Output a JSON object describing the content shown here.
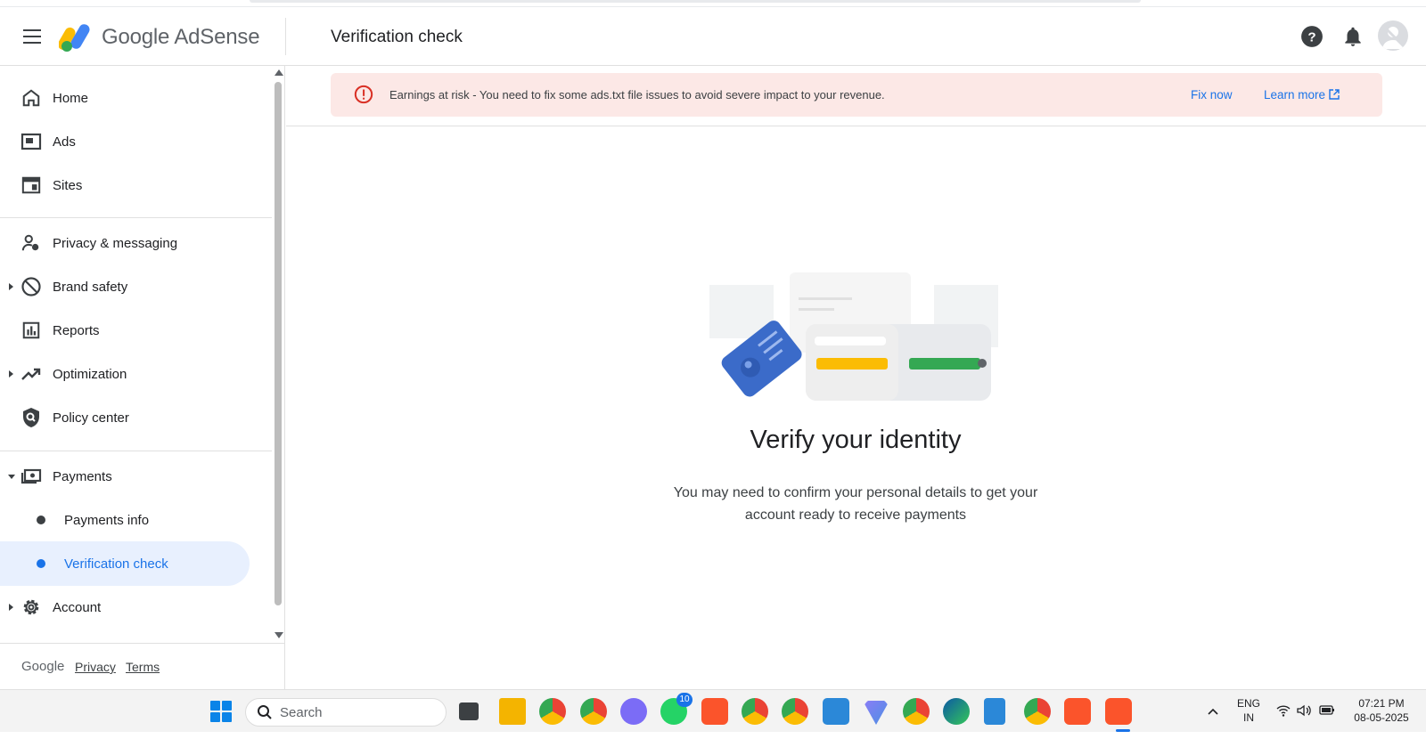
{
  "header": {
    "brand": "Google AdSense",
    "page_title": "Verification check"
  },
  "sidebar": {
    "items": [
      {
        "label": "Home",
        "icon": "home-icon"
      },
      {
        "label": "Ads",
        "icon": "ads-icon"
      },
      {
        "label": "Sites",
        "icon": "sites-icon"
      },
      {
        "label": "Privacy & messaging",
        "icon": "privacy-icon"
      },
      {
        "label": "Brand safety",
        "icon": "block-icon"
      },
      {
        "label": "Reports",
        "icon": "reports-icon"
      },
      {
        "label": "Optimization",
        "icon": "trending-icon"
      },
      {
        "label": "Policy center",
        "icon": "policy-shield-icon"
      },
      {
        "label": "Payments",
        "icon": "payments-icon"
      },
      {
        "label": "Payments info"
      },
      {
        "label": "Verification check"
      },
      {
        "label": "Account",
        "icon": "gear-icon"
      }
    ],
    "footer": {
      "google": "Google",
      "privacy": "Privacy",
      "terms": "Terms"
    }
  },
  "alert": {
    "text": "Earnings at risk - You need to fix some ads.txt file issues to avoid severe impact to your revenue.",
    "fix_now": "Fix now",
    "learn_more": "Learn more"
  },
  "main": {
    "title": "Verify your identity",
    "description": "You may need to confirm your personal details to get your account ready to receive payments"
  },
  "taskbar": {
    "search_label": "Search",
    "whatsapp_badge": "10",
    "lang": "ENG",
    "region": "IN",
    "time": "07:21 PM",
    "date": "08-05-2025"
  },
  "colors": {
    "accent": "#1a73e8",
    "alert_bg": "#fce8e6",
    "alert_icon": "#d93025",
    "active_bg": "#e8f0fe"
  }
}
